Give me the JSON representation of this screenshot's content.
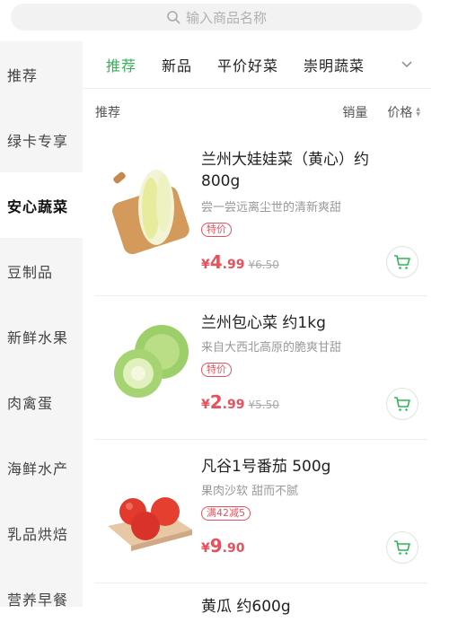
{
  "search": {
    "placeholder": "输入商品名称"
  },
  "sidebar": {
    "items": [
      {
        "label": "推荐"
      },
      {
        "label": "绿卡专享"
      },
      {
        "label": "安心蔬菜"
      },
      {
        "label": "豆制品"
      },
      {
        "label": "新鲜水果"
      },
      {
        "label": "肉禽蛋"
      },
      {
        "label": "海鲜水产"
      },
      {
        "label": "乳品烘焙"
      },
      {
        "label": "营养早餐"
      }
    ]
  },
  "tabs": [
    {
      "label": "推荐"
    },
    {
      "label": "新品"
    },
    {
      "label": "平价好菜"
    },
    {
      "label": "崇明蔬菜"
    }
  ],
  "sortbar": {
    "left": "推荐",
    "sales": "销量",
    "price": "价格"
  },
  "products": [
    {
      "name": "兰州大娃娃菜（黄心）约800g",
      "desc": "尝一尝远离尘世的清新爽甜",
      "tag": "特价",
      "price_symbol": "¥",
      "price_int": "4",
      "price_dec": ".99",
      "old_price": "¥6.50"
    },
    {
      "name": "兰州包心菜 约1kg",
      "desc": "来自大西北高原的脆爽甘甜",
      "tag": "特价",
      "price_symbol": "¥",
      "price_int": "2",
      "price_dec": ".99",
      "old_price": "¥5.50"
    },
    {
      "name": "凡谷1号番茄 500g",
      "desc": "果肉沙软 甜而不腻",
      "tag": "满42减5",
      "price_symbol": "¥",
      "price_int": "9",
      "price_dec": ".90",
      "old_price": ""
    },
    {
      "name": "黄瓜 约600g"
    }
  ],
  "colors": {
    "accent_green": "#2fb556",
    "price_red": "#e8505b"
  }
}
